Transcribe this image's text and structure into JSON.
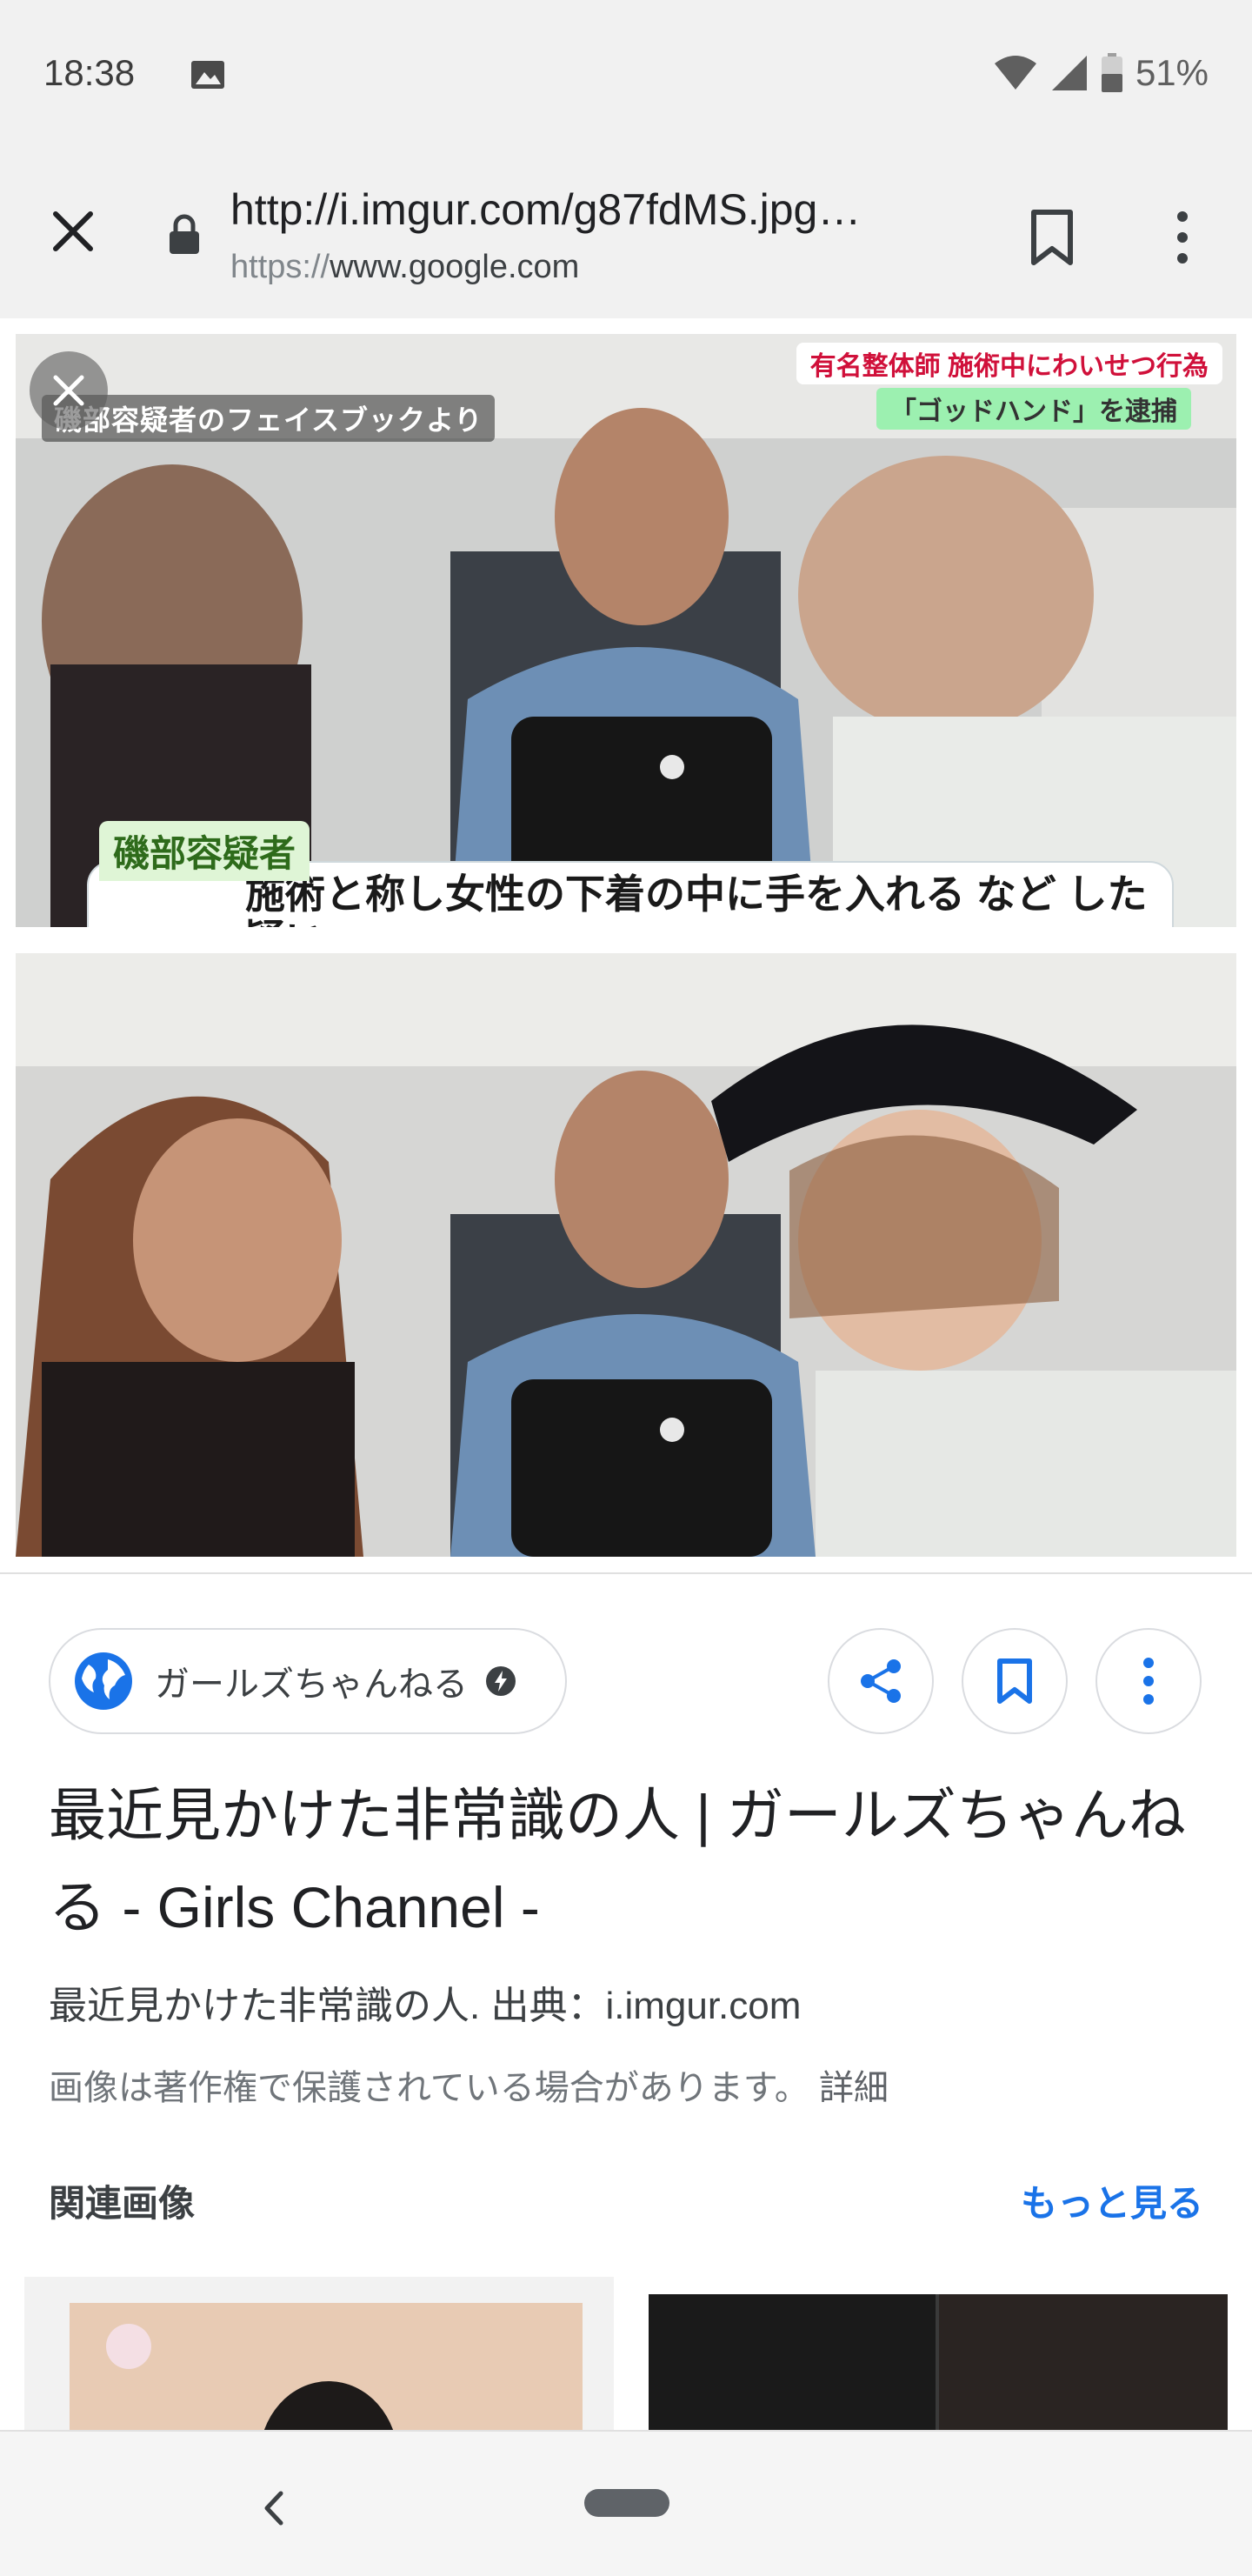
{
  "status_bar": {
    "time": "18:38",
    "battery_percent": "51%",
    "icons": [
      "image-icon",
      "wifi-icon",
      "signal-icon",
      "battery-icon"
    ]
  },
  "url_bar": {
    "title": "http://i.imgur.com/g87fdMS.jpg…",
    "origin_scheme": "https://",
    "origin_host": "www.google.com",
    "icons": [
      "close-icon",
      "lock-icon",
      "bookmark-icon",
      "more-vert-icon"
    ]
  },
  "image": {
    "caption_top_right": "有名整体師 施術中にわいせつ行為",
    "caption_top_right_2": "「ゴッドハンド」を逮捕",
    "caption_source": "磯部容疑者のフェイスブックより",
    "caption_name": "磯部容疑者",
    "caption_body": "施術と称し女性の下着の中に手を入れる など した 疑い"
  },
  "result": {
    "source_name": "ガールズちゃんねる",
    "title": "最近見かけた非常識の人 | ガールズちゃんねる - Girls Channel -",
    "description": "最近見かけた非常識の人. 出典：i.imgur.com",
    "copyright_note": "画像は著作権で保護されている場合があります。",
    "detail_link": "詳細",
    "related_heading": "関連画像",
    "see_more": "もっと見る"
  },
  "colors": {
    "accent_blue": "#1a73e8",
    "chrome_bg": "#f1f1f1",
    "text_primary": "#202124"
  }
}
